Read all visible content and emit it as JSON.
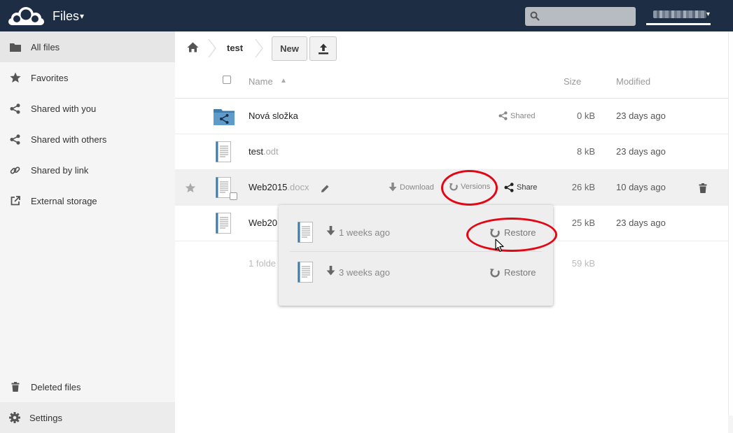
{
  "header": {
    "app_title": "Files",
    "app_caret": "▾",
    "search_placeholder": "",
    "user_caret": "▾"
  },
  "sidebar": {
    "items": [
      {
        "label": "All files",
        "icon": "folder-icon",
        "active": true
      },
      {
        "label": "Favorites",
        "icon": "star-icon"
      },
      {
        "label": "Shared with you",
        "icon": "share-icon"
      },
      {
        "label": "Shared with others",
        "icon": "share-icon"
      },
      {
        "label": "Shared by link",
        "icon": "link-icon"
      },
      {
        "label": "External storage",
        "icon": "external-link-icon"
      }
    ],
    "deleted_files": "Deleted files",
    "settings": "Settings"
  },
  "breadcrumb": {
    "current": "test"
  },
  "toolbar": {
    "new_label": "New"
  },
  "table": {
    "columns": {
      "name": "Name",
      "sort_arrow": "▲",
      "size": "Size",
      "modified": "Modified"
    },
    "rows": [
      {
        "name": "Nová složka",
        "ext": "",
        "size": "0 kB",
        "modified": "23 days ago",
        "type": "shared-folder",
        "shared_label": "Shared"
      },
      {
        "name": "test",
        "ext": ".odt",
        "size": "8 kB",
        "modified": "23 days ago",
        "type": "document"
      },
      {
        "name": "Web2015",
        "ext": ".docx",
        "size": "26 kB",
        "modified": "10 days ago",
        "type": "document",
        "actions": {
          "download": "Download",
          "versions": "Versions",
          "share": "Share"
        }
      },
      {
        "name": "Web20",
        "ext": "",
        "size": "25 kB",
        "modified": "23 days ago",
        "type": "document"
      }
    ],
    "summary": {
      "folders": "1 folde",
      "size": "59 kB"
    }
  },
  "versions": [
    {
      "date": "1 weeks ago",
      "restore": "Restore"
    },
    {
      "date": "3 weeks ago",
      "restore": "Restore"
    }
  ],
  "colors": {
    "header_bg": "#1d2d44",
    "annotation": "#e30613",
    "sidebar_bg": "#f5f5f5"
  }
}
